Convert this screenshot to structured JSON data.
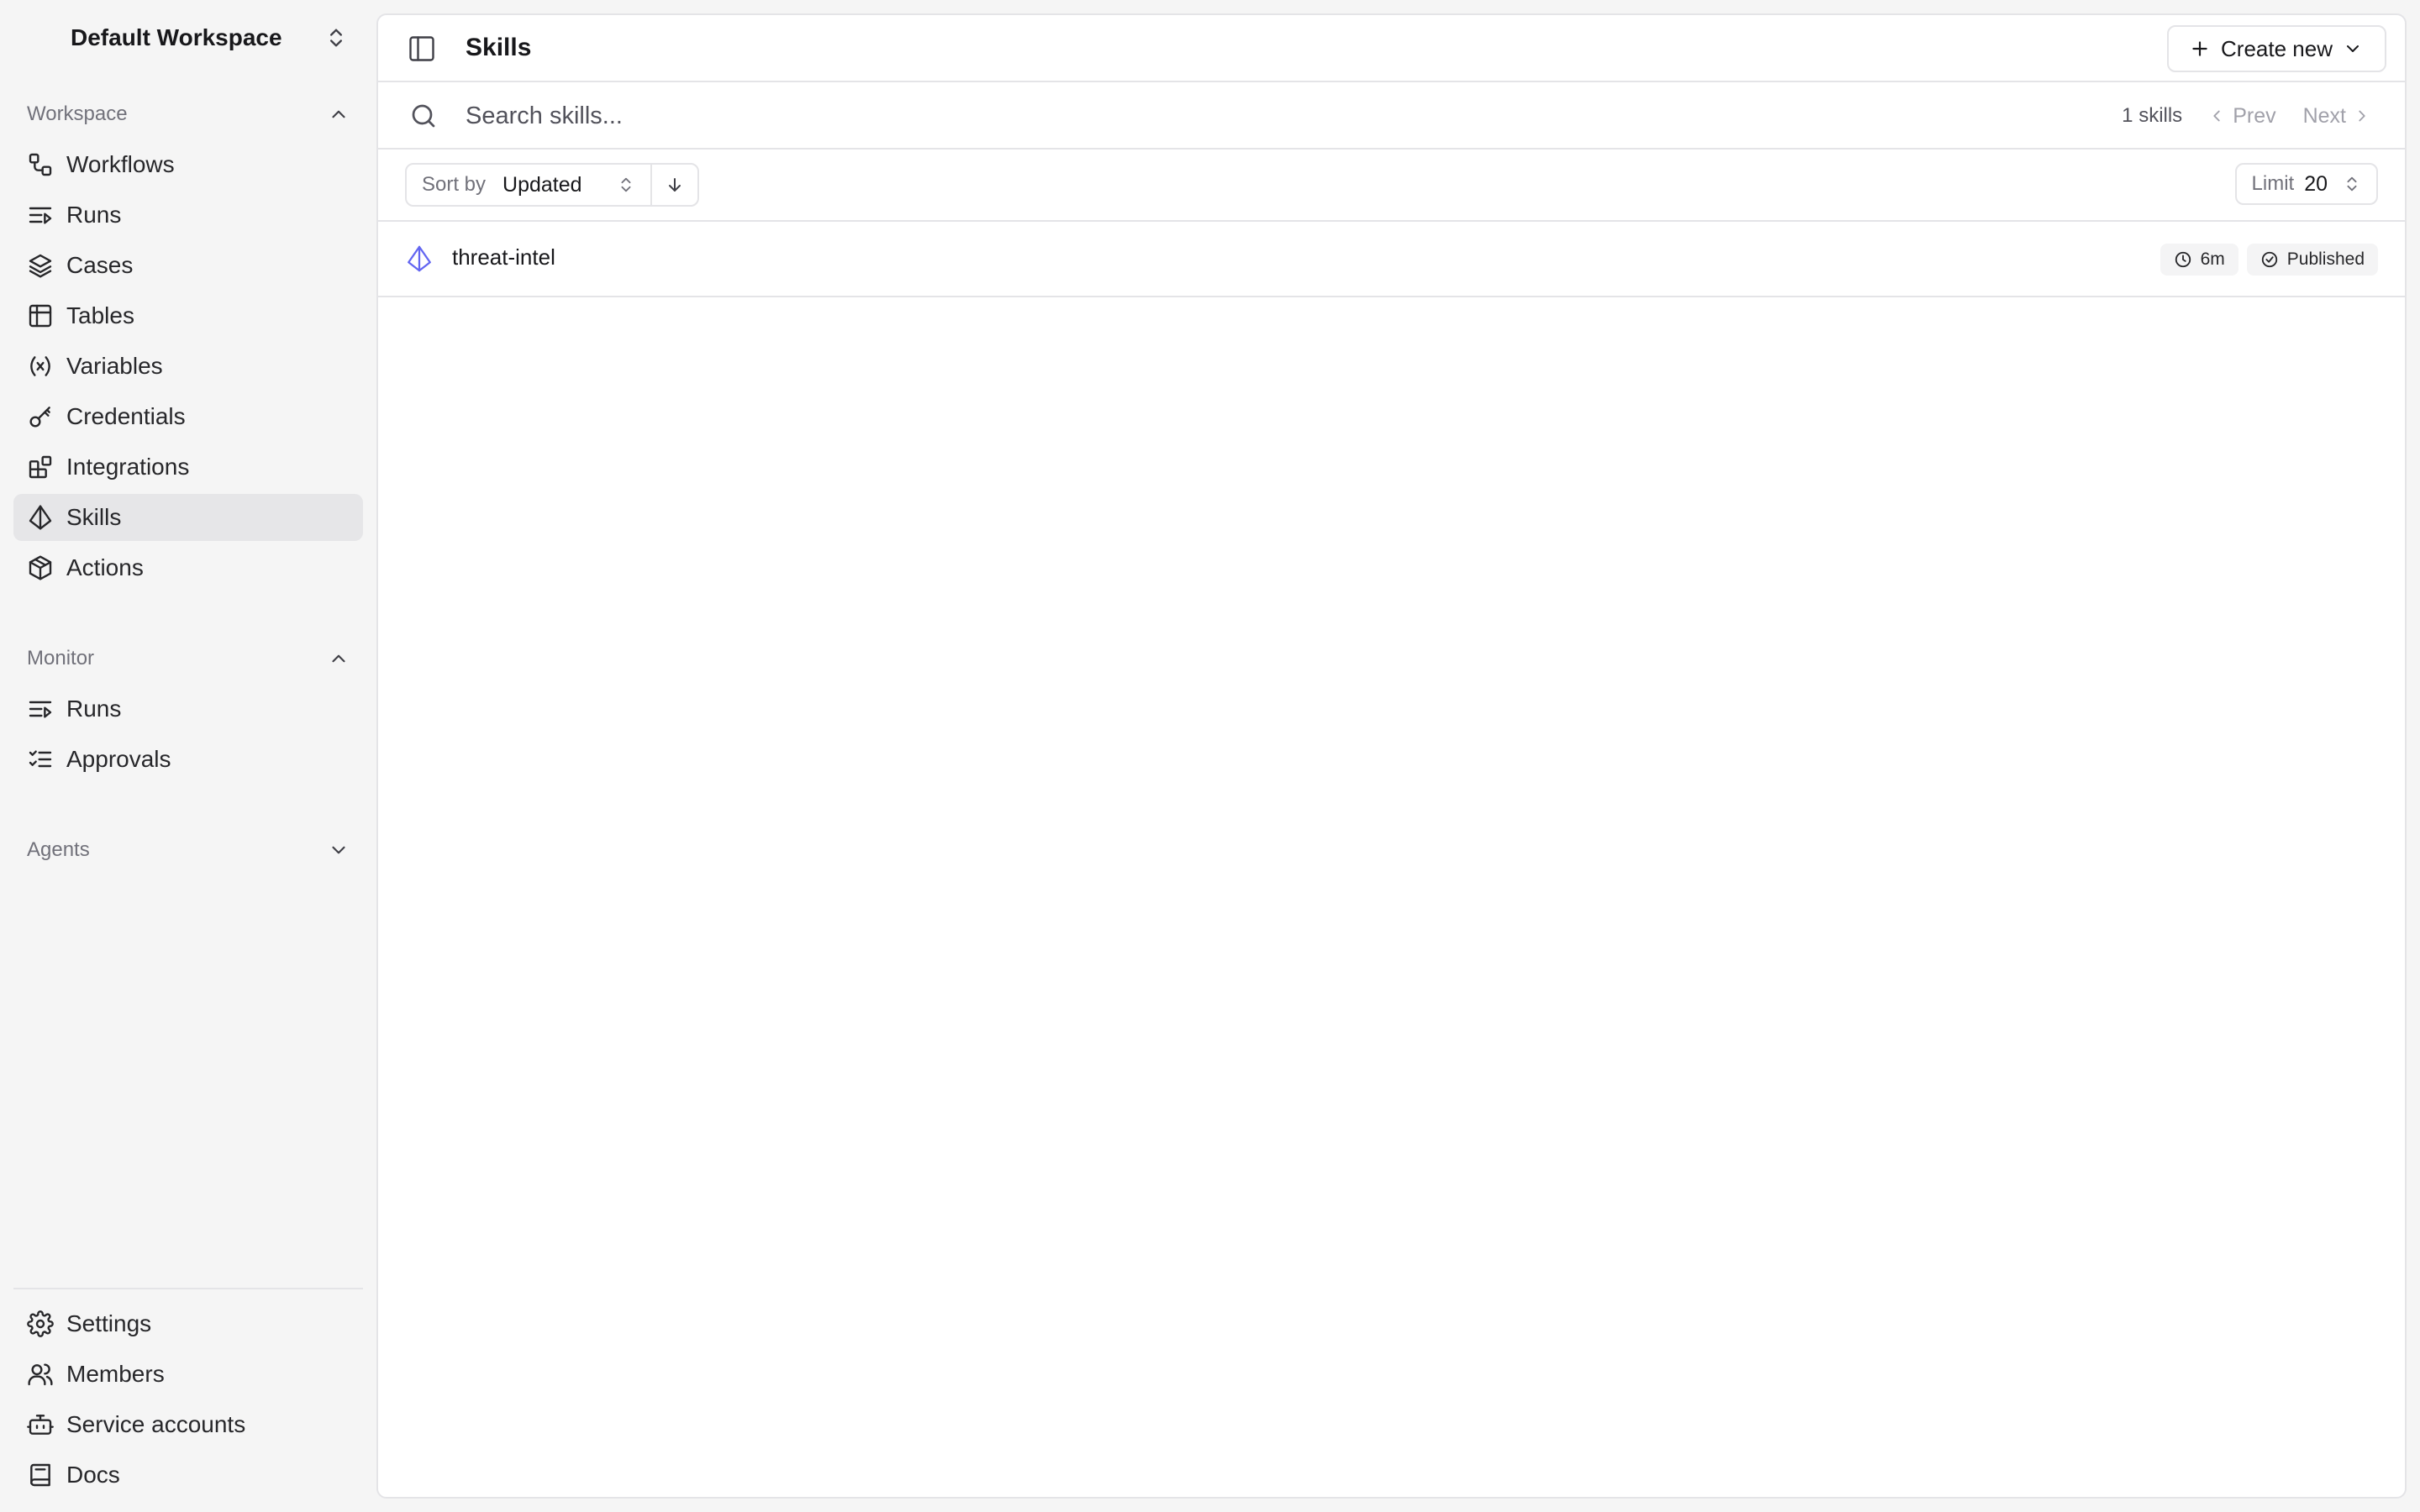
{
  "workspace": {
    "name": "Default Workspace"
  },
  "sidebar": {
    "workspace_group": {
      "label": "Workspace",
      "items": [
        {
          "label": "Workflows",
          "icon": "workflow-icon"
        },
        {
          "label": "Runs",
          "icon": "runs-icon"
        },
        {
          "label": "Cases",
          "icon": "layers-icon"
        },
        {
          "label": "Tables",
          "icon": "table-icon"
        },
        {
          "label": "Variables",
          "icon": "variable-icon"
        },
        {
          "label": "Credentials",
          "icon": "key-icon"
        },
        {
          "label": "Integrations",
          "icon": "blocks-icon"
        },
        {
          "label": "Skills",
          "icon": "skill-icon",
          "active": true
        },
        {
          "label": "Actions",
          "icon": "box-icon"
        }
      ]
    },
    "monitor_group": {
      "label": "Monitor",
      "items": [
        {
          "label": "Runs",
          "icon": "runs-icon"
        },
        {
          "label": "Approvals",
          "icon": "checklist-icon"
        }
      ]
    },
    "agents_group": {
      "label": "Agents",
      "collapsed": true
    },
    "footer_items": [
      {
        "label": "Settings",
        "icon": "gear-icon"
      },
      {
        "label": "Members",
        "icon": "users-icon"
      },
      {
        "label": "Service accounts",
        "icon": "bot-icon"
      },
      {
        "label": "Docs",
        "icon": "book-icon"
      }
    ]
  },
  "header": {
    "title": "Skills",
    "create_label": "Create new"
  },
  "search": {
    "placeholder": "Search skills...",
    "value": "",
    "count_label": "1 skills",
    "prev_label": "Prev",
    "next_label": "Next"
  },
  "toolbar": {
    "sort_prefix": "Sort by",
    "sort_value": "Updated",
    "sort_direction": "descending",
    "limit_prefix": "Limit",
    "limit_value": "20"
  },
  "skills": [
    {
      "name": "threat-intel",
      "updated": "6m",
      "status": "Published"
    }
  ],
  "colors": {
    "accent": "#6366f1",
    "active_bg": "#e6e6e8",
    "border": "#e4e4e7",
    "sidebar_bg": "#f5f5f5"
  }
}
